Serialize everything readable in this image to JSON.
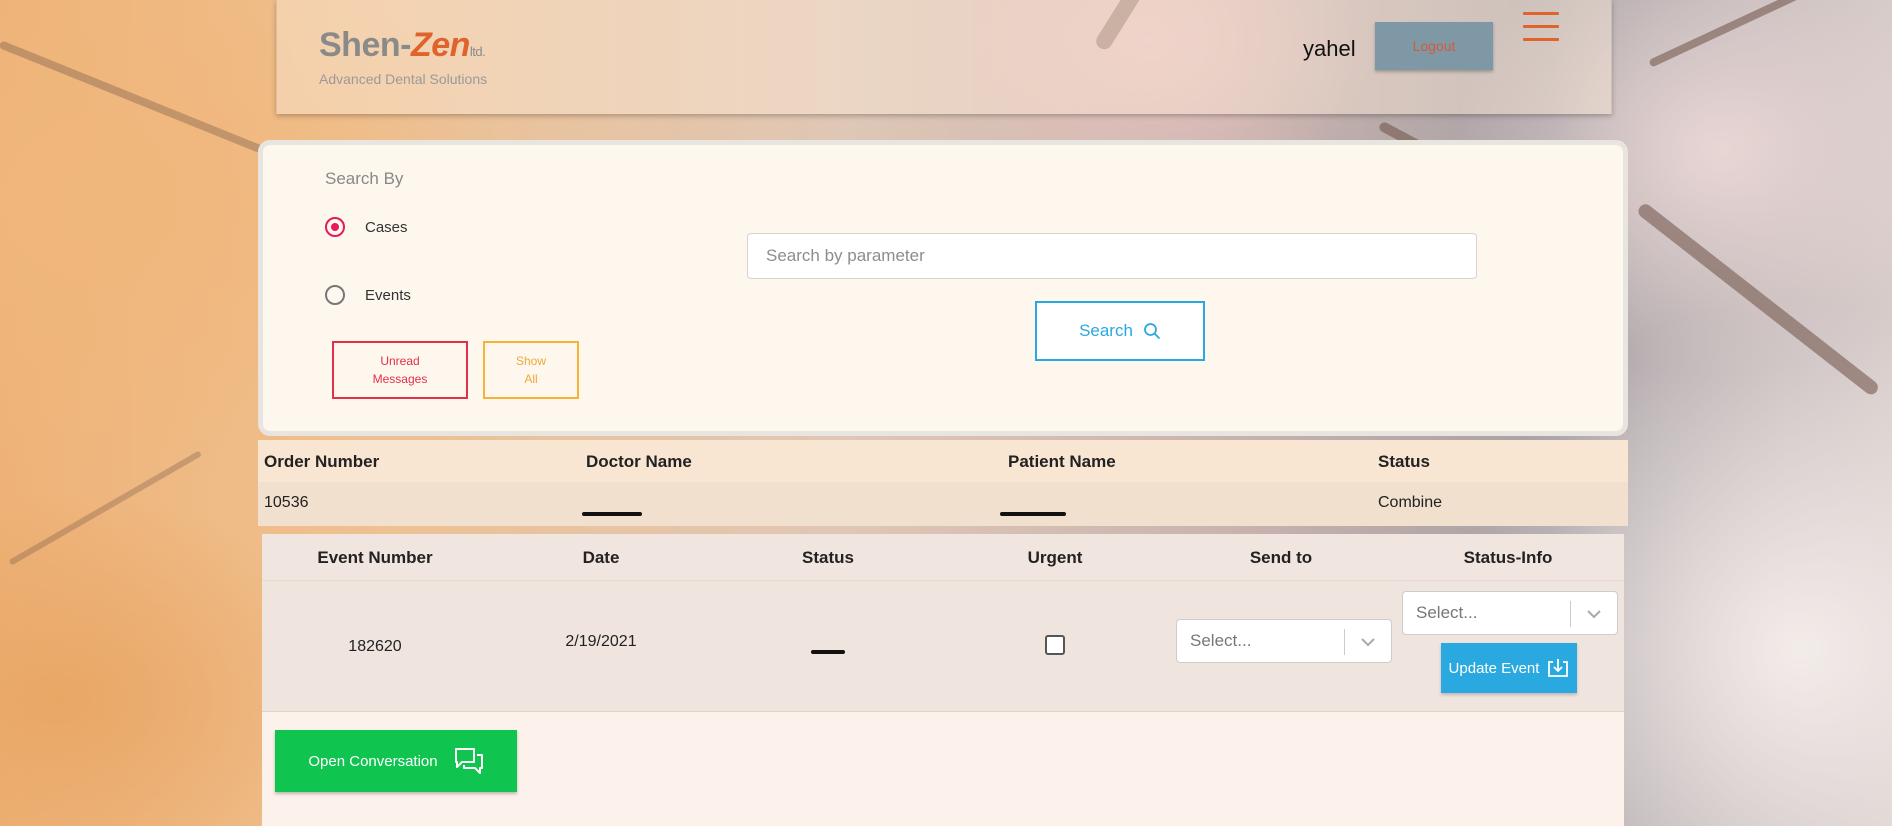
{
  "header": {
    "logo_name_left": "Shen-",
    "logo_name_z": "Zen",
    "logo_ltd": "ltd.",
    "logo_tagline": "Advanced Dental Solutions",
    "username": "yahel",
    "logout_label": "Logout",
    "accent_color": "#e0632e"
  },
  "search_panel": {
    "search_by_label": "Search By",
    "options": [
      {
        "label": "Cases",
        "selected": true
      },
      {
        "label": "Events",
        "selected": false
      }
    ],
    "unread_line1": "Unread",
    "unread_line2": "Messages",
    "showall_line1": "Show",
    "showall_line2": "All",
    "search_placeholder": "Search by parameter",
    "search_value": "",
    "search_button_label": "Search",
    "search_icon": "search-icon"
  },
  "cases_table": {
    "columns": [
      "Order Number",
      "Doctor Name",
      "Patient Name",
      "Status"
    ],
    "rows": [
      {
        "order_number": "10536",
        "doctor_name": "[redacted]",
        "patient_name": "[redacted]",
        "status": "Combine"
      }
    ]
  },
  "events_table": {
    "columns": [
      "Event Number",
      "Date",
      "Status",
      "Urgent",
      "Send to",
      "Status-Info"
    ],
    "rows": [
      {
        "event_number": "182620",
        "date": "2/19/2021",
        "status": "[redacted]",
        "urgent": false,
        "send_to_placeholder": "Select...",
        "status_info_placeholder": "Select...",
        "update_label": "Update Event"
      }
    ],
    "open_conversation_label": "Open Conversation"
  },
  "colors": {
    "primary_blue": "#29a9e0",
    "danger_red": "#e0304a",
    "warning_orange": "#f5b437",
    "success_green": "#0fc44f",
    "radio_selected": "#e61a5a"
  }
}
